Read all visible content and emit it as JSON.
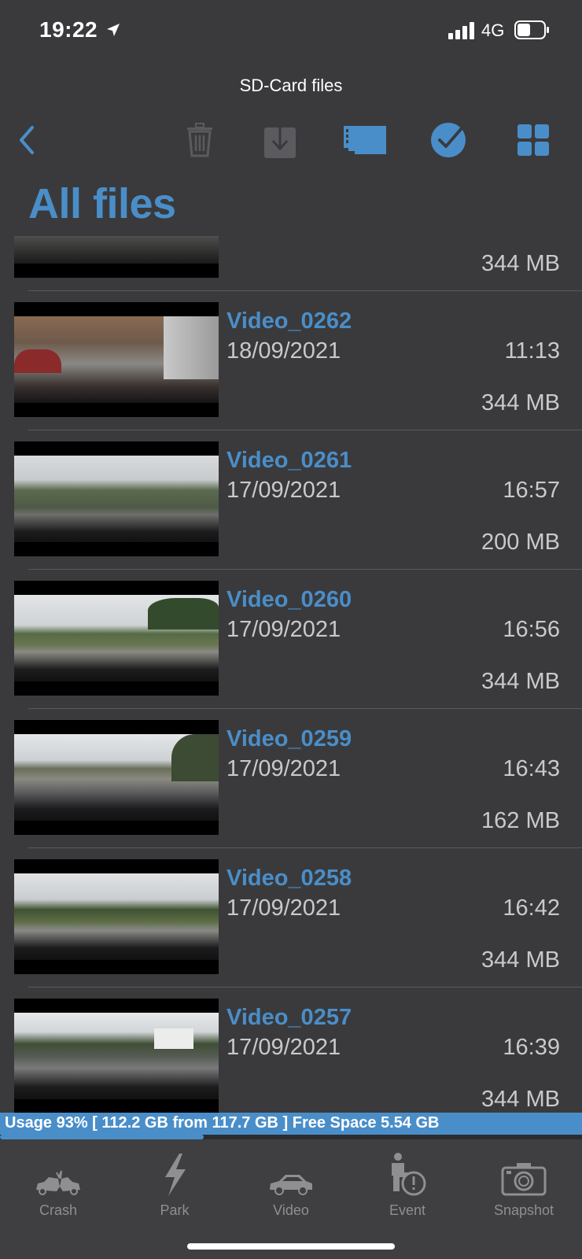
{
  "status": {
    "time": "19:22",
    "network": "4G"
  },
  "nav": {
    "title": "SD-Card files"
  },
  "page": {
    "title": "All files"
  },
  "files": [
    {
      "name": "",
      "date": "",
      "time": "",
      "size": "344 MB"
    },
    {
      "name": "Video_0262",
      "date": "18/09/2021",
      "time": "11:13",
      "size": "344 MB"
    },
    {
      "name": "Video_0261",
      "date": "17/09/2021",
      "time": "16:57",
      "size": "200 MB"
    },
    {
      "name": "Video_0260",
      "date": "17/09/2021",
      "time": "16:56",
      "size": "344 MB"
    },
    {
      "name": "Video_0259",
      "date": "17/09/2021",
      "time": "16:43",
      "size": "162 MB"
    },
    {
      "name": "Video_0258",
      "date": "17/09/2021",
      "time": "16:42",
      "size": "344 MB"
    },
    {
      "name": "Video_0257",
      "date": "17/09/2021",
      "time": "16:39",
      "size": "344 MB"
    }
  ],
  "usage": {
    "text": "Usage 93% [ 112.2 GB from 117.7 GB ]  Free Space 5.54 GB",
    "fraction": 0.35
  },
  "tabs": [
    {
      "label": "Crash",
      "icon": "crash-icon"
    },
    {
      "label": "Park",
      "icon": "lightning-icon"
    },
    {
      "label": "Video",
      "icon": "car-icon"
    },
    {
      "label": "Event",
      "icon": "event-icon"
    },
    {
      "label": "Snapshot",
      "icon": "camera-icon"
    }
  ],
  "colors": {
    "accent": "#4a8ec9",
    "background": "#3a3a3c",
    "inactive": "#8e8e93"
  }
}
